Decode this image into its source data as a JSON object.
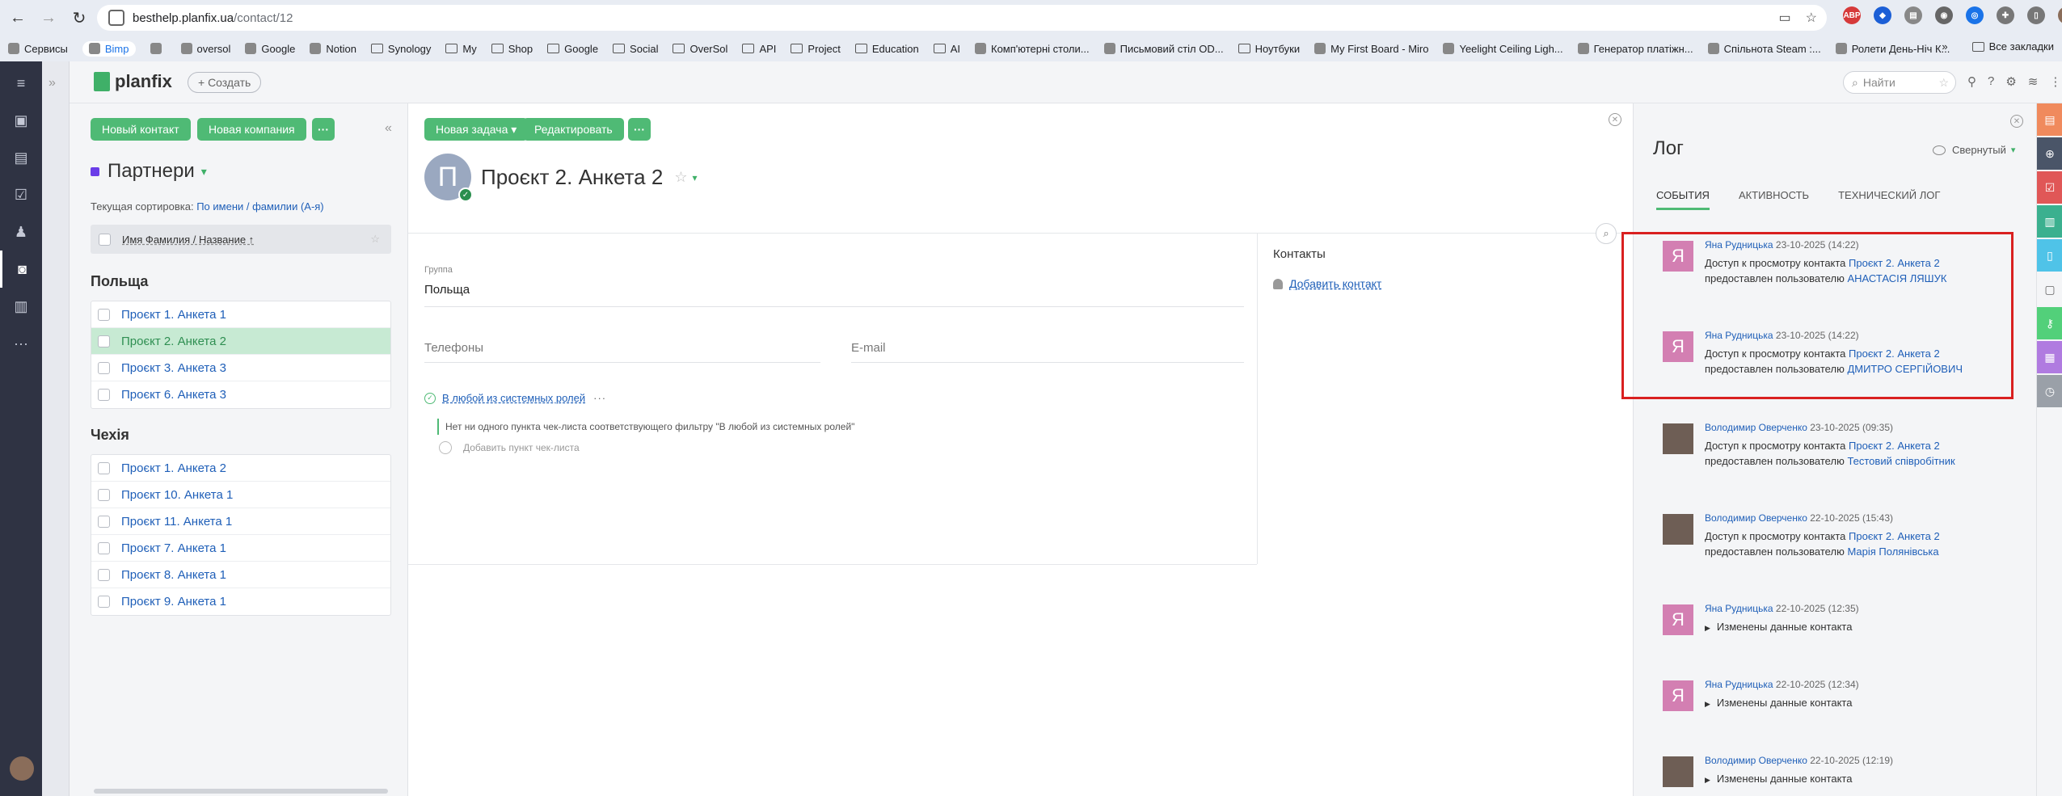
{
  "browser": {
    "url_host": "besthelp.planfix.ua",
    "url_path": "/contact/12",
    "bookmarks": [
      {
        "label": "Сервисы",
        "icon": "apps-icon"
      },
      {
        "label": "Bimp",
        "icon": "bookmark-icon",
        "highlight": true
      },
      {
        "label": "",
        "icon": "grid-icon"
      },
      {
        "label": "oversol",
        "icon": "bookmark-icon"
      },
      {
        "label": "Google",
        "icon": "google-drive-icon"
      },
      {
        "label": "Notion",
        "icon": "notion-icon"
      },
      {
        "label": "Synology",
        "icon": "folder-icon"
      },
      {
        "label": "My",
        "icon": "folder-icon"
      },
      {
        "label": "Shop",
        "icon": "folder-icon"
      },
      {
        "label": "Google",
        "icon": "folder-icon"
      },
      {
        "label": "Social",
        "icon": "folder-icon"
      },
      {
        "label": "OverSol",
        "icon": "folder-icon"
      },
      {
        "label": "API",
        "icon": "folder-icon"
      },
      {
        "label": "Project",
        "icon": "folder-icon"
      },
      {
        "label": "Education",
        "icon": "folder-icon"
      },
      {
        "label": "AI",
        "icon": "folder-icon"
      },
      {
        "label": "Комп'ютерні столи...",
        "icon": "bookmark-icon"
      },
      {
        "label": "Письмовий стіл OD...",
        "icon": "bookmark-icon"
      },
      {
        "label": "Ноутбуки",
        "icon": "folder-icon"
      },
      {
        "label": "My First Board - Miro",
        "icon": "miro-icon"
      },
      {
        "label": "Yeelight Ceiling Ligh...",
        "icon": "youtube-icon"
      },
      {
        "label": "Генератор платіжн...",
        "icon": "bookmark-icon"
      },
      {
        "label": "Спільнота Steam :...",
        "icon": "steam-icon"
      },
      {
        "label": "Ролети День-Ніч К...",
        "icon": "bookmark-icon"
      }
    ],
    "all_bookmarks": "Все закладки",
    "more_chevron": "»"
  },
  "app": {
    "logo": "planfix",
    "create_button": "+ Создать",
    "search_placeholder": "Найти"
  },
  "left_panel": {
    "new_contact": "Новый контакт",
    "new_company": "Новая компания",
    "more": "···",
    "collapse": "«",
    "title": "Партнери",
    "sort_label": "Текущая сортировка:",
    "sort_value": "По имени / фамилии (А-я)",
    "column_header": "Имя Фамилия / Название ↑",
    "groups": [
      {
        "name": "Польща",
        "items": [
          {
            "label": "Проєкт 1. Анкета 1",
            "selected": false
          },
          {
            "label": "Проєкт 2. Анкета 2",
            "selected": true
          },
          {
            "label": "Проєкт 3. Анкета 3",
            "selected": false
          },
          {
            "label": "Проєкт 6. Анкета 3",
            "selected": false
          }
        ]
      },
      {
        "name": "Чехія",
        "items": [
          {
            "label": "Проєкт 1. Анкета 2",
            "selected": false
          },
          {
            "label": "Проєкт 10. Анкета 1",
            "selected": false
          },
          {
            "label": "Проєкт 11. Анкета 1",
            "selected": false
          },
          {
            "label": "Проєкт 7. Анкета 1",
            "selected": false
          },
          {
            "label": "Проєкт 8. Анкета 1",
            "selected": false
          },
          {
            "label": "Проєкт 9. Анкета 1",
            "selected": false
          }
        ]
      }
    ]
  },
  "card": {
    "new_task": "Новая задача ▾",
    "edit": "Редактировать",
    "more": "···",
    "avatar_letter": "П",
    "title": "Проєкт 2. Анкета 2",
    "group_label": "Группа",
    "group_value": "Польща",
    "phones_placeholder": "Телефоны",
    "email_placeholder": "E-mail",
    "checklist_filter": "В любой из системных ролей",
    "checklist_empty": "Нет ни одного пункта чек-листа соответствующего фильтру \"В любой из системных ролей\"",
    "add_checklist_item": "Добавить пункт чек-листа",
    "contacts_title": "Контакты",
    "add_contact": "Добавить контакт"
  },
  "log": {
    "title": "Лог",
    "collapse_mode": "Свернутый",
    "tabs": [
      {
        "label": "События",
        "active": true
      },
      {
        "label": "Активность",
        "active": false
      },
      {
        "label": "Технический лог",
        "active": false
      }
    ],
    "entries": [
      {
        "author": "Яна Рудницька",
        "time": "23-10-2025 (14:22)",
        "avatar": "Я",
        "kind": "ya",
        "line1": "Доступ к просмотру контакта ",
        "link1": "Проєкт 2. Анкета 2",
        "line2": "предоставлен пользователю ",
        "link2": "АНАСТАСІЯ ЛЯШУК"
      },
      {
        "author": "Яна Рудницька",
        "time": "23-10-2025 (14:22)",
        "avatar": "Я",
        "kind": "ya",
        "line1": "Доступ к просмотру контакта ",
        "link1": "Проєкт 2. Анкета 2",
        "line2": "предоставлен пользователю ",
        "link2": "ДМИТРО СЕРГІЙОВИЧ"
      },
      {
        "author": "Володимир Оверченко",
        "time": "23-10-2025 (09:35)",
        "avatar": "",
        "kind": "vo",
        "line1": "Доступ к просмотру контакта ",
        "link1": "Проєкт 2. Анкета 2",
        "line2": "предоставлен пользователю ",
        "link2": "Тестовий співробітник"
      },
      {
        "author": "Володимир Оверченко",
        "time": "22-10-2025 (15:43)",
        "avatar": "",
        "kind": "vo",
        "line1": "Доступ к просмотру контакта ",
        "link1": "Проєкт 2. Анкета 2",
        "line2": "предоставлен пользователю ",
        "link2": "Марія Полянівська"
      },
      {
        "author": "Яна Рудницька",
        "time": "22-10-2025 (12:35)",
        "avatar": "Я",
        "kind": "ya",
        "changed": "Изменены данные контакта"
      },
      {
        "author": "Яна Рудницька",
        "time": "22-10-2025 (12:34)",
        "avatar": "Я",
        "kind": "ya",
        "changed": "Изменены данные контакта"
      },
      {
        "author": "Володимир Оверченко",
        "time": "22-10-2025 (12:19)",
        "avatar": "",
        "kind": "vo",
        "changed": "Изменены данные контакта"
      }
    ]
  },
  "colors": {
    "accent_green": "#4fba75",
    "link_blue": "#1f5fb8",
    "sidebar_dark": "#2f3343",
    "highlight_red": "#d92020"
  }
}
